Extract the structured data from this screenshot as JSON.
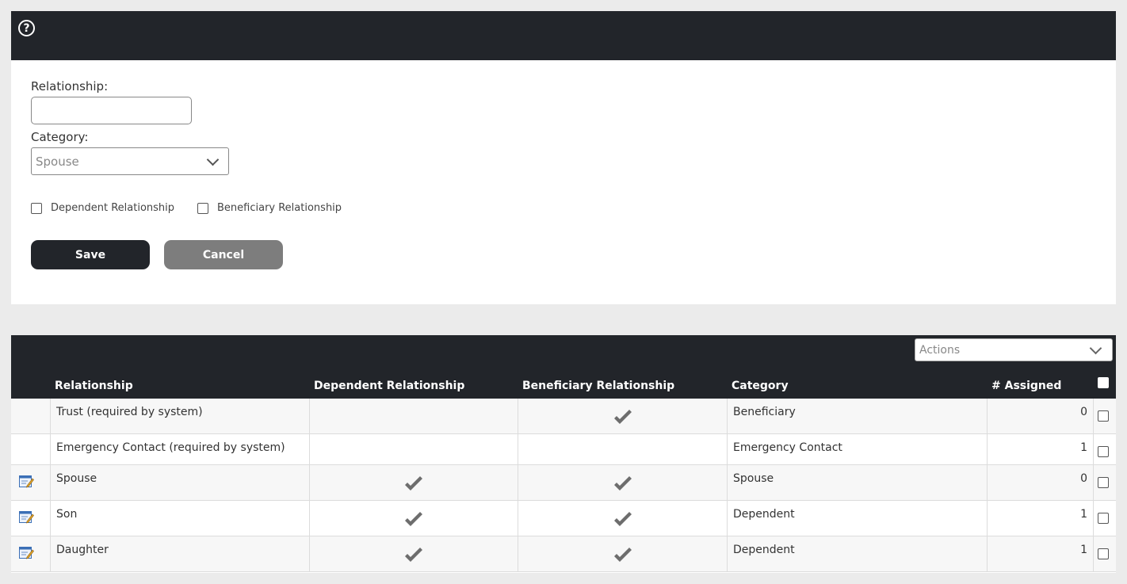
{
  "form": {
    "relationship_label": "Relationship:",
    "relationship_value": "",
    "category_label": "Category:",
    "category_value": "Spouse",
    "dependent_checkbox_label": "Dependent Relationship",
    "beneficiary_checkbox_label": "Beneficiary Relationship",
    "save_label": "Save",
    "cancel_label": "Cancel"
  },
  "grid": {
    "actions_placeholder": "Actions",
    "columns": {
      "relationship": "Relationship",
      "dependent": "Dependent Relationship",
      "beneficiary": "Beneficiary Relationship",
      "category": "Category",
      "assigned": "# Assigned"
    },
    "rows": [
      {
        "relationship": "Trust (required by system)",
        "dependent": false,
        "beneficiary": true,
        "category": "Beneficiary",
        "assigned": "0",
        "editable": false
      },
      {
        "relationship": "Emergency Contact (required by system)",
        "dependent": false,
        "beneficiary": false,
        "category": "Emergency Contact",
        "assigned": "1",
        "editable": false
      },
      {
        "relationship": "Spouse",
        "dependent": true,
        "beneficiary": true,
        "category": "Spouse",
        "assigned": "0",
        "editable": true
      },
      {
        "relationship": "Son",
        "dependent": true,
        "beneficiary": true,
        "category": "Dependent",
        "assigned": "1",
        "editable": true
      },
      {
        "relationship": "Daughter",
        "dependent": true,
        "beneficiary": true,
        "category": "Dependent",
        "assigned": "1",
        "editable": true
      }
    ]
  },
  "icons": {
    "help": "help-icon",
    "edit": "edit-icon",
    "check": "check-icon",
    "chevron": "chevron-down-icon"
  },
  "colors": {
    "header_bg": "#22252a",
    "save_bg": "#22252a",
    "cancel_bg": "#7d7d7d",
    "page_bg": "#ebebeb"
  }
}
